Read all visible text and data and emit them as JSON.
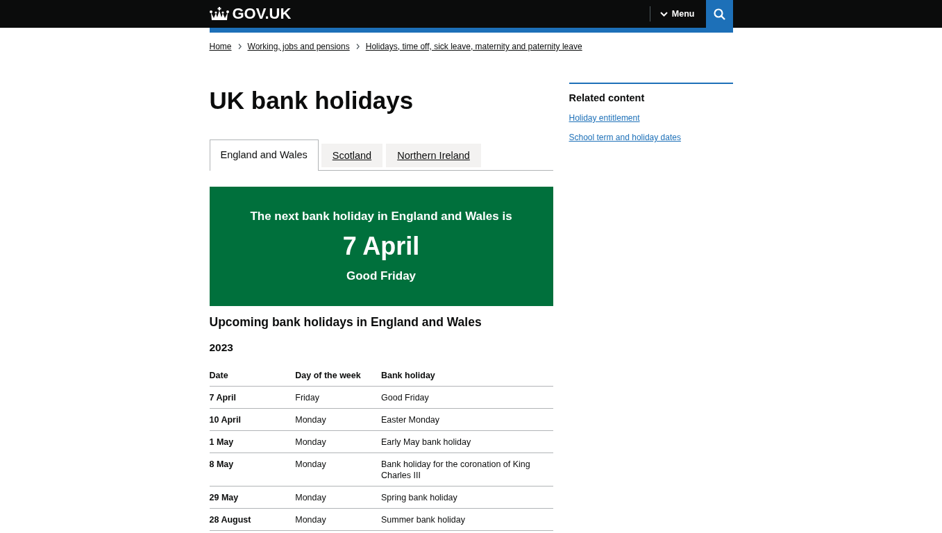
{
  "header": {
    "logo": "GOV.UK",
    "menu_button": "Menu"
  },
  "breadcrumbs": [
    "Home",
    "Working, jobs and pensions",
    "Holidays, time off, sick leave, maternity and paternity leave"
  ],
  "title": "UK bank holidays",
  "tabs": [
    {
      "label": "England and Wales",
      "selected": true
    },
    {
      "label": "Scotland",
      "selected": false
    },
    {
      "label": "Northern Ireland",
      "selected": false
    }
  ],
  "next_holiday_panel": {
    "intro": "The next bank holiday in England and Wales is",
    "date": "7 April",
    "name": "Good Friday"
  },
  "section_heading": "Upcoming bank holidays in England and Wales",
  "year": "2023",
  "table": {
    "columns": [
      "Date",
      "Day of the week",
      "Bank holiday"
    ],
    "rows": [
      {
        "date": "7 April",
        "day": "Friday",
        "holiday": "Good Friday"
      },
      {
        "date": "10 April",
        "day": "Monday",
        "holiday": "Easter Monday"
      },
      {
        "date": "1 May",
        "day": "Monday",
        "holiday": "Early May bank holiday"
      },
      {
        "date": "8 May",
        "day": "Monday",
        "holiday": "Bank holiday for the coronation of King Charles III"
      },
      {
        "date": "29 May",
        "day": "Monday",
        "holiday": "Spring bank holiday"
      },
      {
        "date": "28 August",
        "day": "Monday",
        "holiday": "Summer bank holiday"
      }
    ]
  },
  "related_content": {
    "title": "Related content",
    "links": [
      "Holiday entitlement",
      "School term and holiday dates"
    ]
  }
}
